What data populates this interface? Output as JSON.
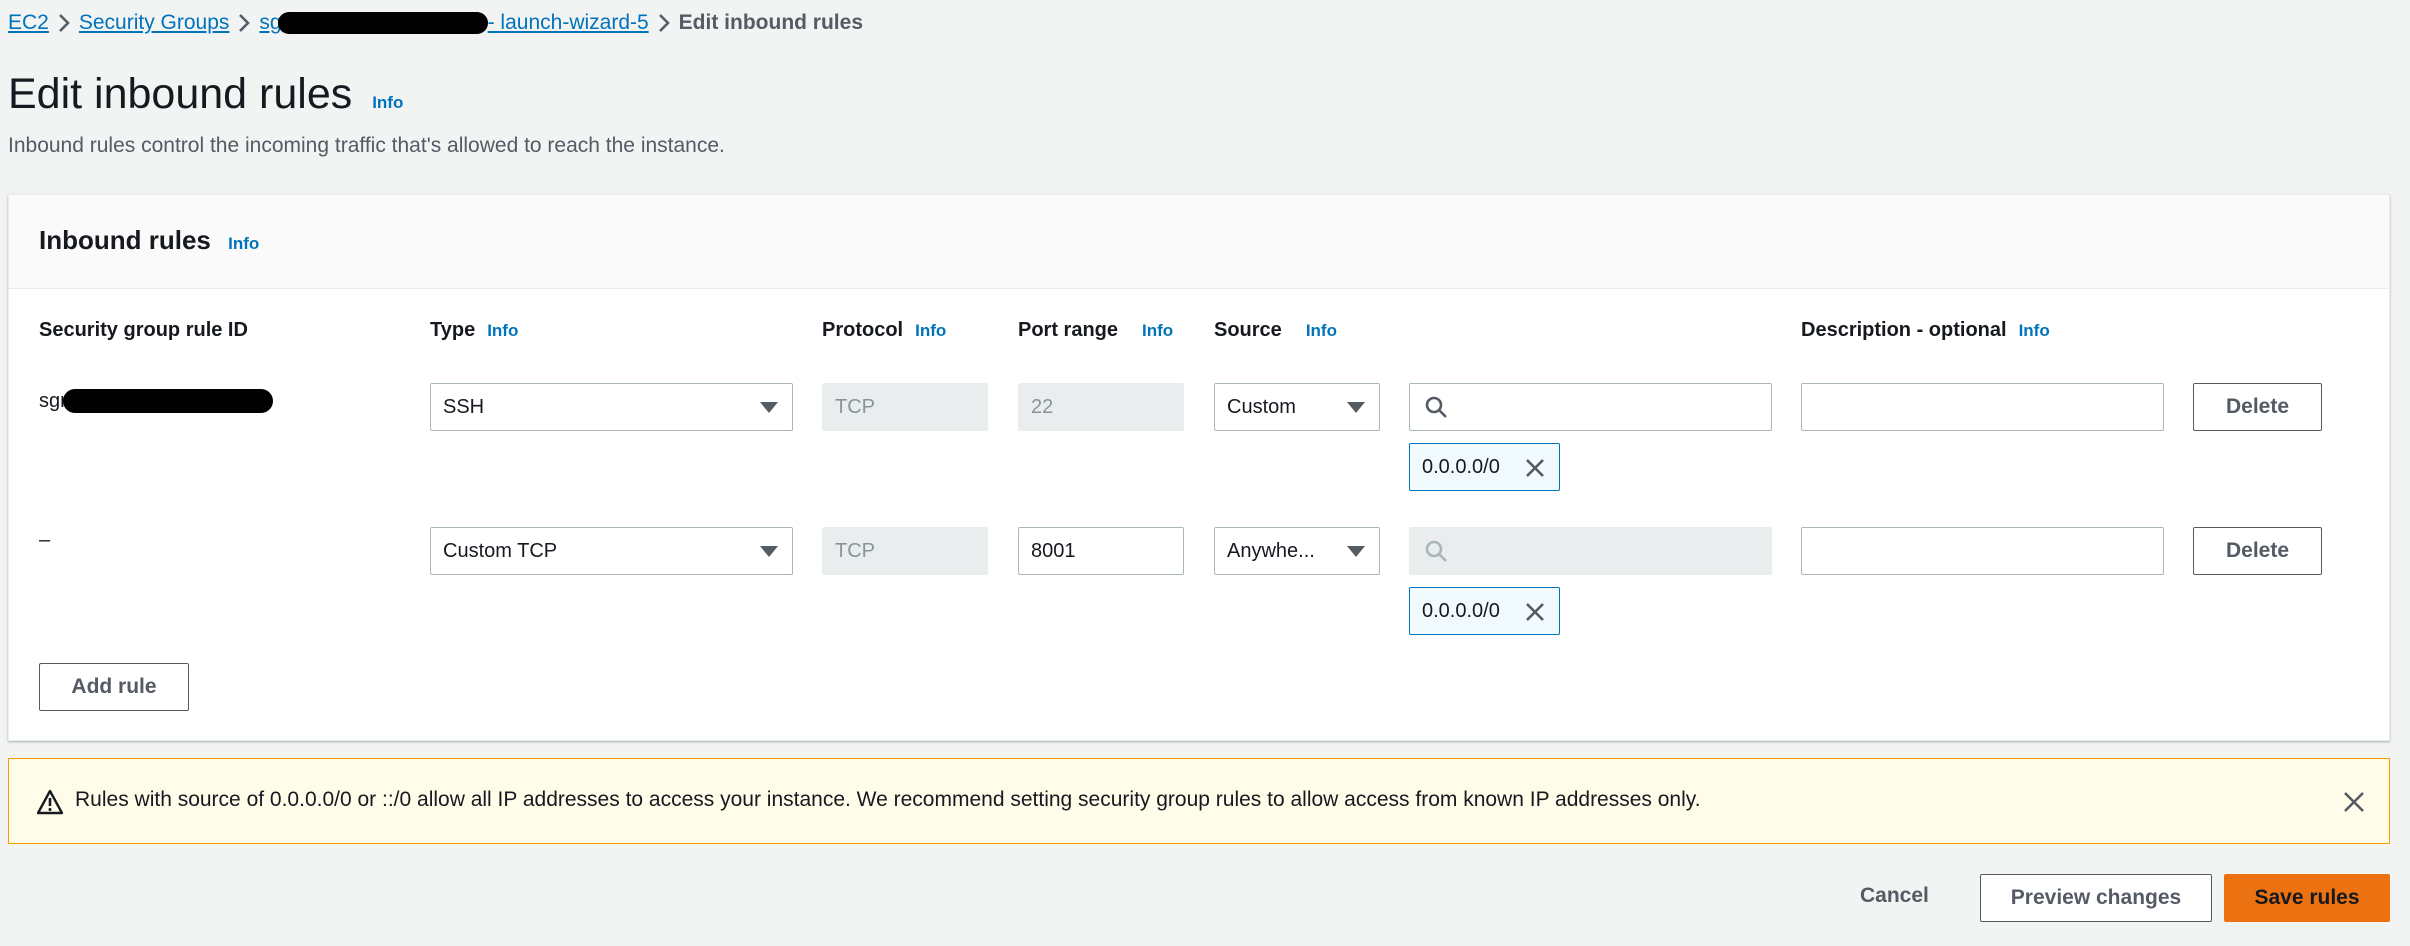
{
  "breadcrumb": {
    "ec2": "EC2",
    "security_groups": "Security Groups",
    "sg_prefix": "sg",
    "sg_suffix": "- launch-wizard-5",
    "current": "Edit inbound rules"
  },
  "page": {
    "title": "Edit inbound rules",
    "info": "Info",
    "subtitle": "Inbound rules control the incoming traffic that's allowed to reach the instance."
  },
  "panel": {
    "title": "Inbound rules",
    "info": "Info",
    "columns": {
      "rule_id": "Security group rule ID",
      "type": "Type",
      "protocol": "Protocol",
      "port_range": "Port range",
      "source": "Source",
      "description": "Description - optional",
      "info": "Info"
    },
    "rows": [
      {
        "rule_id": "sgr-",
        "type": "SSH",
        "protocol": "TCP",
        "port_range": "22",
        "source": "Custom",
        "search_value": "",
        "token": "0.0.0.0/0",
        "description": "",
        "delete": "Delete"
      },
      {
        "rule_id": "–",
        "type": "Custom TCP",
        "protocol": "TCP",
        "port_range": "8001",
        "source": "Anywhe...",
        "search_value": "",
        "token": "0.0.0.0/0",
        "description": "",
        "delete": "Delete"
      }
    ],
    "add_rule": "Add rule"
  },
  "alert": {
    "text": "Rules with source of 0.0.0.0/0 or ::/0 allow all IP addresses to access your instance. We recommend setting security group rules to allow access from known IP addresses only.",
    "icon": "warning-icon"
  },
  "footer": {
    "cancel": "Cancel",
    "preview": "Preview changes",
    "save": "Save rules"
  },
  "colors": {
    "link": "#0073bb",
    "primary": "#ec7211",
    "warning_border": "#ff9900",
    "warning_bg": "#fffce9"
  }
}
